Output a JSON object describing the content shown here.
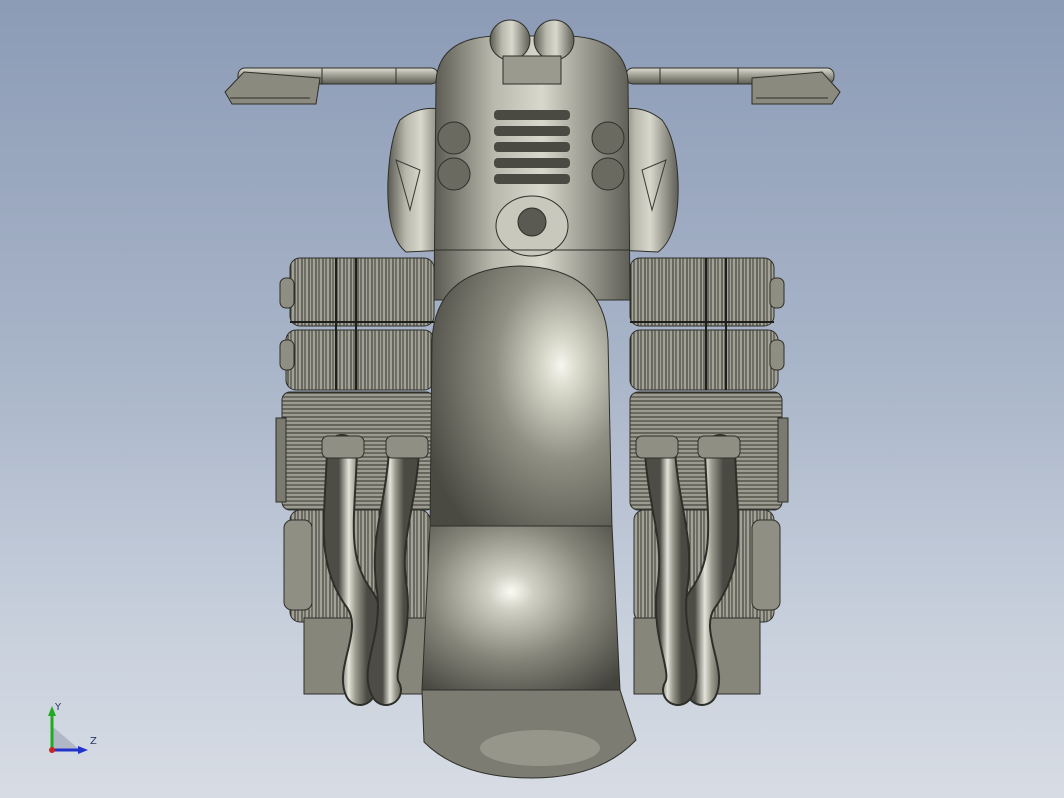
{
  "viewport": {
    "background_top": "#8c9bb6",
    "background_bottom": "#d7dce4"
  },
  "model": {
    "icon": "motorcycle-engine-render",
    "body_color": "#8e8e83",
    "shadow_color": "#3a3a35",
    "highlight_color": "#f2f2ec"
  },
  "triad": {
    "y_label": "Y",
    "z_label": "Z",
    "y_color": "#22aa22",
    "z_color": "#2233cc",
    "x_color": "#cc2222"
  }
}
